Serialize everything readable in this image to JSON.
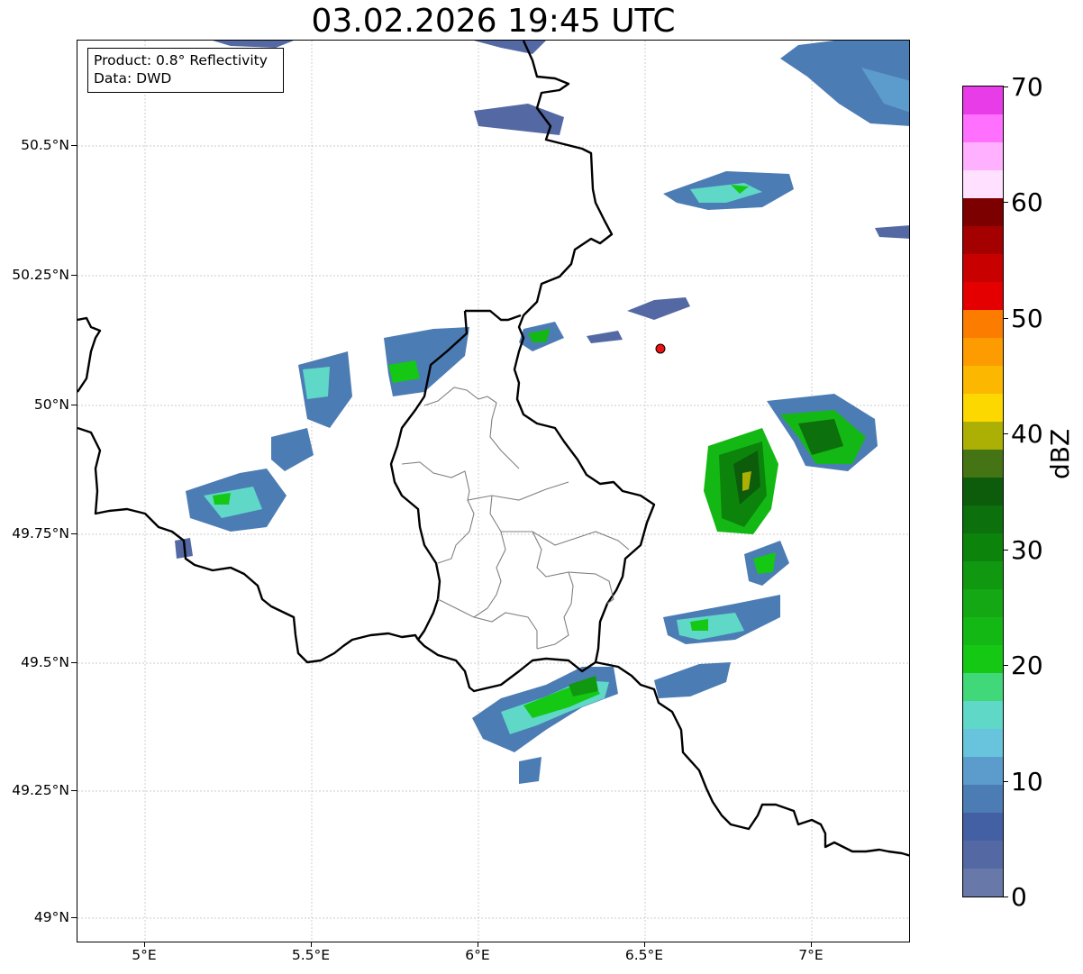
{
  "title": "03.02.2026 19:45 UTC",
  "info_box": {
    "product": "Product: 0.8° Reflectivity",
    "data": "Data: DWD"
  },
  "axes": {
    "lon_ticks": [
      "5°E",
      "5.5°E",
      "6°E",
      "6.5°E",
      "7°E"
    ],
    "lat_ticks": [
      "50.5°N",
      "50.25°N",
      "50°N",
      "49.75°N",
      "49.5°N",
      "49.25°N",
      "49°N"
    ]
  },
  "colorbar": {
    "label": "dBZ",
    "ticks": [
      "0",
      "10",
      "20",
      "30",
      "40",
      "50",
      "60",
      "70"
    ],
    "range": [
      0,
      70
    ],
    "step": 2.5,
    "colors": [
      "#6878a8",
      "#5468a4",
      "#4460a4",
      "#4c7cb4",
      "#5c9ccc",
      "#68c4dc",
      "#60d8c8",
      "#40d878",
      "#14c814",
      "#14b814",
      "#14a814",
      "#109810",
      "#0c840c",
      "#0c700c",
      "#0c5c0c",
      "#447414",
      "#acb004",
      "#fcd800",
      "#fcb800",
      "#fc9c00",
      "#fc7c00",
      "#e40000",
      "#c80000",
      "#a40000",
      "#7c0000",
      "#ffe0ff",
      "#ffb0ff",
      "#ff70ff",
      "#e83ce8"
    ]
  },
  "marker": {
    "color": "#ee1111",
    "lon": 6.55,
    "lat": 50.11
  },
  "colors": {
    "border": "#000000",
    "admin": "#808080",
    "grid": "#bbbbbb"
  }
}
